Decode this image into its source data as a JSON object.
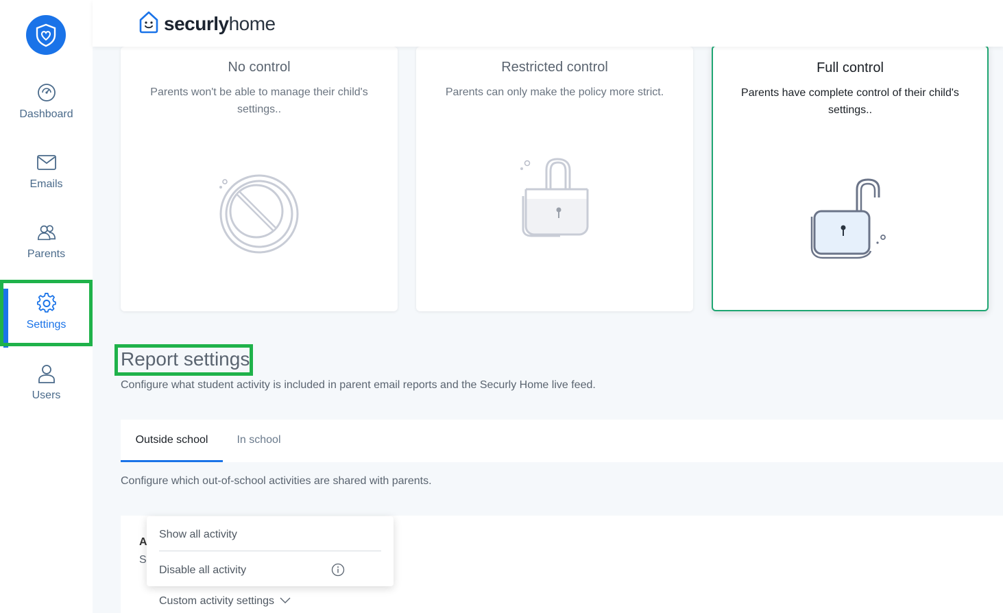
{
  "app": {
    "brand_bold": "securly",
    "brand_light": "home"
  },
  "sidebar": {
    "logo_icon": "shield-heart-icon",
    "items": [
      {
        "label": "Dashboard",
        "icon": "gauge-icon"
      },
      {
        "label": "Emails",
        "icon": "envelope-icon"
      },
      {
        "label": "Parents",
        "icon": "users-icon"
      },
      {
        "label": "Settings",
        "icon": "gear-icon",
        "active": true
      },
      {
        "label": "Users",
        "icon": "user-icon"
      }
    ]
  },
  "control_cards": [
    {
      "title": "No control",
      "description": "Parents won't be able to manage their child's settings..",
      "icon": "prohibited-icon"
    },
    {
      "title": "Restricted control",
      "description": "Parents can only make the policy more strict.",
      "icon": "locked-padlock-icon"
    },
    {
      "title": "Full control",
      "description": "Parents have complete control of their child's settings..",
      "icon": "unlocked-padlock-icon",
      "selected": true
    }
  ],
  "report": {
    "title": "Report settings",
    "description": "Configure what student activity is included in parent email reports and the Securly Home live feed."
  },
  "tabs": [
    {
      "label": "Outside school",
      "active": true
    },
    {
      "label": "In school",
      "active": false
    }
  ],
  "tab_description": "Configure which out-of-school activities are shared with parents.",
  "panel": {
    "label_a": "A",
    "label_s": "S"
  },
  "dropdown": {
    "options": [
      "Show all activity",
      "Disable all activity"
    ],
    "current": "Custom activity settings"
  },
  "colors": {
    "accent": "#1a73e8",
    "selected_border": "#1ea672",
    "highlight": "#1fb24a"
  }
}
